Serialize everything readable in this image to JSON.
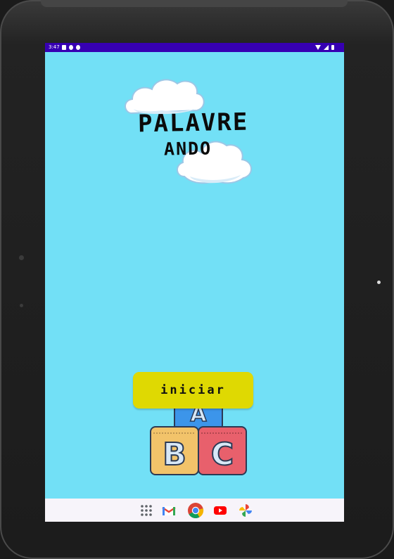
{
  "status_bar": {
    "time": "3:47",
    "left_icons": [
      "sd-card-icon",
      "notification-icon",
      "notification-icon"
    ],
    "right_icons": [
      "wifi-icon",
      "cell-signal-icon",
      "battery-icon"
    ],
    "background": "#3700b3"
  },
  "app": {
    "background": "#72e0f6",
    "logo": {
      "line1": "PALAVRE",
      "line2": "ANDO"
    },
    "start_button": {
      "label": "iniciar",
      "color": "#dfd902"
    },
    "blocks": {
      "letters": [
        "A",
        "B",
        "C"
      ],
      "colors": {
        "A": "#3c95ea",
        "B": "#f2c36a",
        "C": "#e8606c",
        "outline": "#2b3a55"
      }
    }
  },
  "nav_bar": {
    "apps": [
      "app-drawer-icon",
      "gmail-icon",
      "chrome-icon",
      "youtube-icon",
      "photos-icon"
    ],
    "background": "#f7f4fa"
  }
}
